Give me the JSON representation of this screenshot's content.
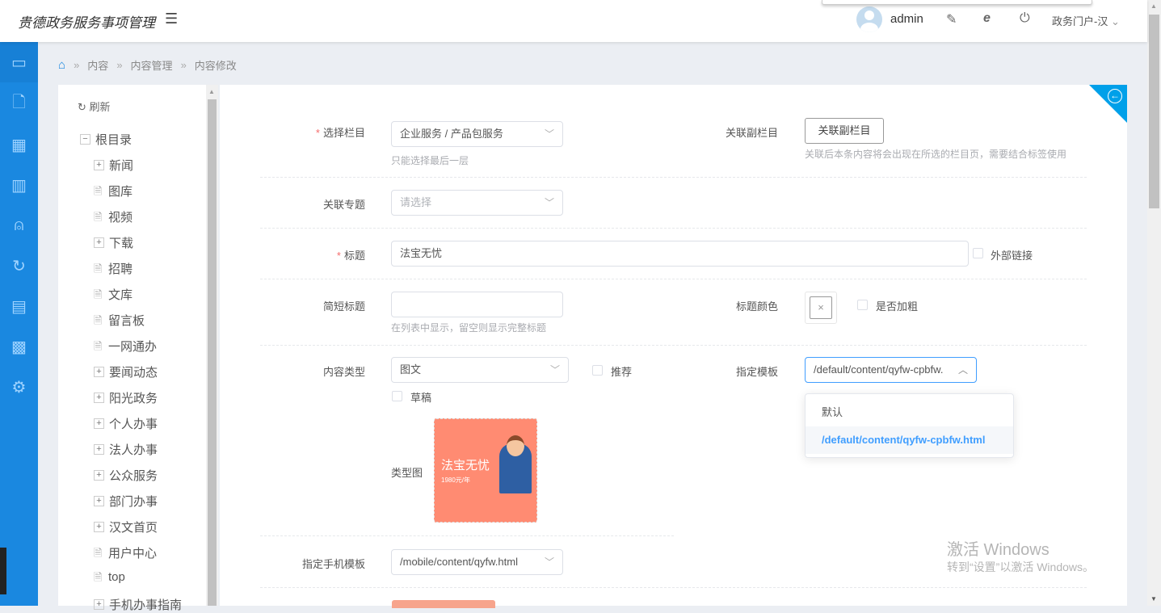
{
  "header": {
    "title": "贵德政务服务事项管理",
    "menu_icon": "☰",
    "username": "admin",
    "portal": "政务门户-汉"
  },
  "breadcrumb": [
    "内容",
    "内容管理",
    "内容修改"
  ],
  "tree": {
    "refresh": "刷新",
    "root": "根目录",
    "items": [
      {
        "label": "新闻",
        "type": "folder"
      },
      {
        "label": "图库",
        "type": "doc"
      },
      {
        "label": "视频",
        "type": "doc"
      },
      {
        "label": "下载",
        "type": "folder"
      },
      {
        "label": "招聘",
        "type": "doc"
      },
      {
        "label": "文库",
        "type": "doc"
      },
      {
        "label": "留言板",
        "type": "doc"
      },
      {
        "label": "一网通办",
        "type": "doc"
      },
      {
        "label": "要闻动态",
        "type": "folder"
      },
      {
        "label": "阳光政务",
        "type": "folder"
      },
      {
        "label": "个人办事",
        "type": "folder"
      },
      {
        "label": "法人办事",
        "type": "folder"
      },
      {
        "label": "公众服务",
        "type": "folder"
      },
      {
        "label": "部门办事",
        "type": "folder"
      },
      {
        "label": "汉文首页",
        "type": "folder"
      },
      {
        "label": "用户中心",
        "type": "doc"
      },
      {
        "label": "top",
        "type": "doc"
      },
      {
        "label": "手机办事指南",
        "type": "folder"
      }
    ]
  },
  "form": {
    "category_label": "选择栏目",
    "category_value": "企业服务 / 产品包服务",
    "category_hint": "只能选择最后一层",
    "sub_label": "关联副栏目",
    "sub_button": "关联副栏目",
    "sub_hint": "关联后本条内容将会出现在所选的栏目页，需要结合标签使用",
    "topic_label": "关联专题",
    "topic_placeholder": "请选择",
    "title_label": "标题",
    "title_value": "法宝无忧",
    "external_link": "外部链接",
    "short_title_label": "简短标题",
    "short_title_value": "",
    "short_title_hint": "在列表中显示，留空则显示完整标题",
    "title_color_label": "标题颜色",
    "bold_label": "是否加粗",
    "content_type_label": "内容类型",
    "content_type_value": "图文",
    "recommend": "推荐",
    "draft": "草稿",
    "template_label": "指定模板",
    "template_value": "/default/content/qyfw-cpbfw.",
    "template_options": [
      "默认",
      "/default/content/qyfw-cpbfw.html"
    ],
    "type_image_label": "类型图",
    "type_image_title": "法宝无忧",
    "type_image_price": "1980元/年",
    "mobile_template_label": "指定手机模板",
    "mobile_template_value": "/mobile/content/qyfw.html"
  },
  "watermark": {
    "line1": "激活 Windows",
    "line2": "转到“设置”以激活 Windows。"
  }
}
